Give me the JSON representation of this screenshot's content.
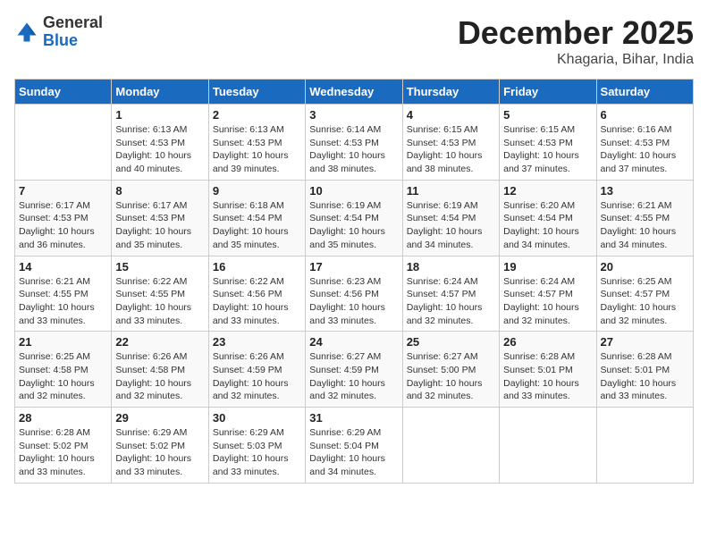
{
  "logo": {
    "general": "General",
    "blue": "Blue"
  },
  "title": {
    "month_year": "December 2025",
    "location": "Khagaria, Bihar, India"
  },
  "columns": [
    "Sunday",
    "Monday",
    "Tuesday",
    "Wednesday",
    "Thursday",
    "Friday",
    "Saturday"
  ],
  "weeks": [
    [
      {
        "day": "",
        "info": ""
      },
      {
        "day": "1",
        "info": "Sunrise: 6:13 AM\nSunset: 4:53 PM\nDaylight: 10 hours\nand 40 minutes."
      },
      {
        "day": "2",
        "info": "Sunrise: 6:13 AM\nSunset: 4:53 PM\nDaylight: 10 hours\nand 39 minutes."
      },
      {
        "day": "3",
        "info": "Sunrise: 6:14 AM\nSunset: 4:53 PM\nDaylight: 10 hours\nand 38 minutes."
      },
      {
        "day": "4",
        "info": "Sunrise: 6:15 AM\nSunset: 4:53 PM\nDaylight: 10 hours\nand 38 minutes."
      },
      {
        "day": "5",
        "info": "Sunrise: 6:15 AM\nSunset: 4:53 PM\nDaylight: 10 hours\nand 37 minutes."
      },
      {
        "day": "6",
        "info": "Sunrise: 6:16 AM\nSunset: 4:53 PM\nDaylight: 10 hours\nand 37 minutes."
      }
    ],
    [
      {
        "day": "7",
        "info": "Sunrise: 6:17 AM\nSunset: 4:53 PM\nDaylight: 10 hours\nand 36 minutes."
      },
      {
        "day": "8",
        "info": "Sunrise: 6:17 AM\nSunset: 4:53 PM\nDaylight: 10 hours\nand 35 minutes."
      },
      {
        "day": "9",
        "info": "Sunrise: 6:18 AM\nSunset: 4:54 PM\nDaylight: 10 hours\nand 35 minutes."
      },
      {
        "day": "10",
        "info": "Sunrise: 6:19 AM\nSunset: 4:54 PM\nDaylight: 10 hours\nand 35 minutes."
      },
      {
        "day": "11",
        "info": "Sunrise: 6:19 AM\nSunset: 4:54 PM\nDaylight: 10 hours\nand 34 minutes."
      },
      {
        "day": "12",
        "info": "Sunrise: 6:20 AM\nSunset: 4:54 PM\nDaylight: 10 hours\nand 34 minutes."
      },
      {
        "day": "13",
        "info": "Sunrise: 6:21 AM\nSunset: 4:55 PM\nDaylight: 10 hours\nand 34 minutes."
      }
    ],
    [
      {
        "day": "14",
        "info": "Sunrise: 6:21 AM\nSunset: 4:55 PM\nDaylight: 10 hours\nand 33 minutes."
      },
      {
        "day": "15",
        "info": "Sunrise: 6:22 AM\nSunset: 4:55 PM\nDaylight: 10 hours\nand 33 minutes."
      },
      {
        "day": "16",
        "info": "Sunrise: 6:22 AM\nSunset: 4:56 PM\nDaylight: 10 hours\nand 33 minutes."
      },
      {
        "day": "17",
        "info": "Sunrise: 6:23 AM\nSunset: 4:56 PM\nDaylight: 10 hours\nand 33 minutes."
      },
      {
        "day": "18",
        "info": "Sunrise: 6:24 AM\nSunset: 4:57 PM\nDaylight: 10 hours\nand 32 minutes."
      },
      {
        "day": "19",
        "info": "Sunrise: 6:24 AM\nSunset: 4:57 PM\nDaylight: 10 hours\nand 32 minutes."
      },
      {
        "day": "20",
        "info": "Sunrise: 6:25 AM\nSunset: 4:57 PM\nDaylight: 10 hours\nand 32 minutes."
      }
    ],
    [
      {
        "day": "21",
        "info": "Sunrise: 6:25 AM\nSunset: 4:58 PM\nDaylight: 10 hours\nand 32 minutes."
      },
      {
        "day": "22",
        "info": "Sunrise: 6:26 AM\nSunset: 4:58 PM\nDaylight: 10 hours\nand 32 minutes."
      },
      {
        "day": "23",
        "info": "Sunrise: 6:26 AM\nSunset: 4:59 PM\nDaylight: 10 hours\nand 32 minutes."
      },
      {
        "day": "24",
        "info": "Sunrise: 6:27 AM\nSunset: 4:59 PM\nDaylight: 10 hours\nand 32 minutes."
      },
      {
        "day": "25",
        "info": "Sunrise: 6:27 AM\nSunset: 5:00 PM\nDaylight: 10 hours\nand 32 minutes."
      },
      {
        "day": "26",
        "info": "Sunrise: 6:28 AM\nSunset: 5:01 PM\nDaylight: 10 hours\nand 33 minutes."
      },
      {
        "day": "27",
        "info": "Sunrise: 6:28 AM\nSunset: 5:01 PM\nDaylight: 10 hours\nand 33 minutes."
      }
    ],
    [
      {
        "day": "28",
        "info": "Sunrise: 6:28 AM\nSunset: 5:02 PM\nDaylight: 10 hours\nand 33 minutes."
      },
      {
        "day": "29",
        "info": "Sunrise: 6:29 AM\nSunset: 5:02 PM\nDaylight: 10 hours\nand 33 minutes."
      },
      {
        "day": "30",
        "info": "Sunrise: 6:29 AM\nSunset: 5:03 PM\nDaylight: 10 hours\nand 33 minutes."
      },
      {
        "day": "31",
        "info": "Sunrise: 6:29 AM\nSunset: 5:04 PM\nDaylight: 10 hours\nand 34 minutes."
      },
      {
        "day": "",
        "info": ""
      },
      {
        "day": "",
        "info": ""
      },
      {
        "day": "",
        "info": ""
      }
    ]
  ]
}
